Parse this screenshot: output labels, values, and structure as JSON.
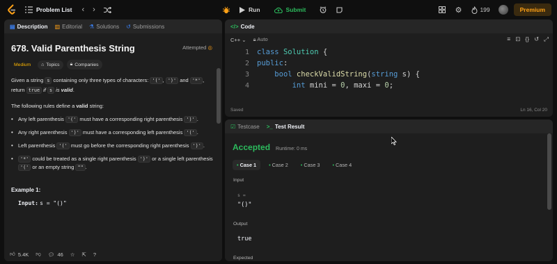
{
  "topbar": {
    "problem_list": "Problem List",
    "run": "Run",
    "submit": "Submit",
    "streak": "199",
    "premium": "Premium"
  },
  "left": {
    "tabs": [
      {
        "label": "Description",
        "icon": "document-icon"
      },
      {
        "label": "Editorial",
        "icon": "book-icon"
      },
      {
        "label": "Solutions",
        "icon": "flask-icon"
      },
      {
        "label": "Submissions",
        "icon": "history-icon"
      }
    ],
    "title": "678. Valid Parenthesis String",
    "status": "Attempted",
    "difficulty": "Medium",
    "topics": "Topics",
    "companies": "Companies",
    "p1": {
      "a": "Given a string ",
      "s": "s",
      "b": " containing only three types of characters: ",
      "c1": "'('",
      "comma1": ", ",
      "c2": "')'",
      "and": " and",
      "c3": "'*'",
      "c": ", return ",
      "true": "true",
      "if": " if ",
      "s2": "s",
      "is": " is ",
      "valid": "valid",
      "dot": "."
    },
    "p2": {
      "a": "The following rules define a ",
      "b": "valid",
      "c": " string:"
    },
    "rules": [
      {
        "pre": "Any left parenthesis ",
        "code": "'('",
        "post": " must have a corresponding right parenthesis ",
        "code2": "')'",
        "end": "."
      },
      {
        "pre": "Any right parenthesis ",
        "code": "')'",
        "post": " must have a corresponding left parenthesis ",
        "code2": "'('",
        "end": "."
      },
      {
        "pre": "Left parenthesis ",
        "code": "'('",
        "post": " must go before the corresponding right parenthesis ",
        "code2": "')'",
        "end": "."
      },
      {
        "pre": "",
        "code": "'*'",
        "post": " could be treated as a single right parenthesis ",
        "code2": "')'",
        "end": " or a single left parenthesis ",
        "code3": "'('",
        "end2": " or an empty string ",
        "code4": "\"\"",
        "end3": "."
      }
    ],
    "example_title": "Example 1:",
    "example_input_label": "Input:",
    "example_input_value": "s = \"()\"",
    "footer": {
      "likes": "5.4K",
      "comments": "46"
    }
  },
  "code": {
    "tab": "Code",
    "language": "C++",
    "mode": "Auto",
    "lines": [
      {
        "n": "1",
        "text": "class Solution {"
      },
      {
        "n": "2",
        "text": "public:"
      },
      {
        "n": "3",
        "text": "    bool checkValidString(string s) {"
      },
      {
        "n": "4",
        "text": "        int mini = 0, maxi = 0;"
      }
    ],
    "saved": "Saved",
    "position": "Ln 16, Col 20"
  },
  "test": {
    "tabs": [
      {
        "label": "Testcase",
        "icon": "checkbox-icon"
      },
      {
        "label": "Test Result",
        "icon": "terminal-icon"
      }
    ],
    "accepted": "Accepted",
    "runtime": "Runtime: 0 ms",
    "cases": [
      "Case 1",
      "Case 2",
      "Case 3",
      "Case 4"
    ],
    "input_label": "Input",
    "input_var": "s =",
    "input_value": "\"()\"",
    "output_label": "Output",
    "output_value": "true",
    "expected_label": "Expected"
  }
}
